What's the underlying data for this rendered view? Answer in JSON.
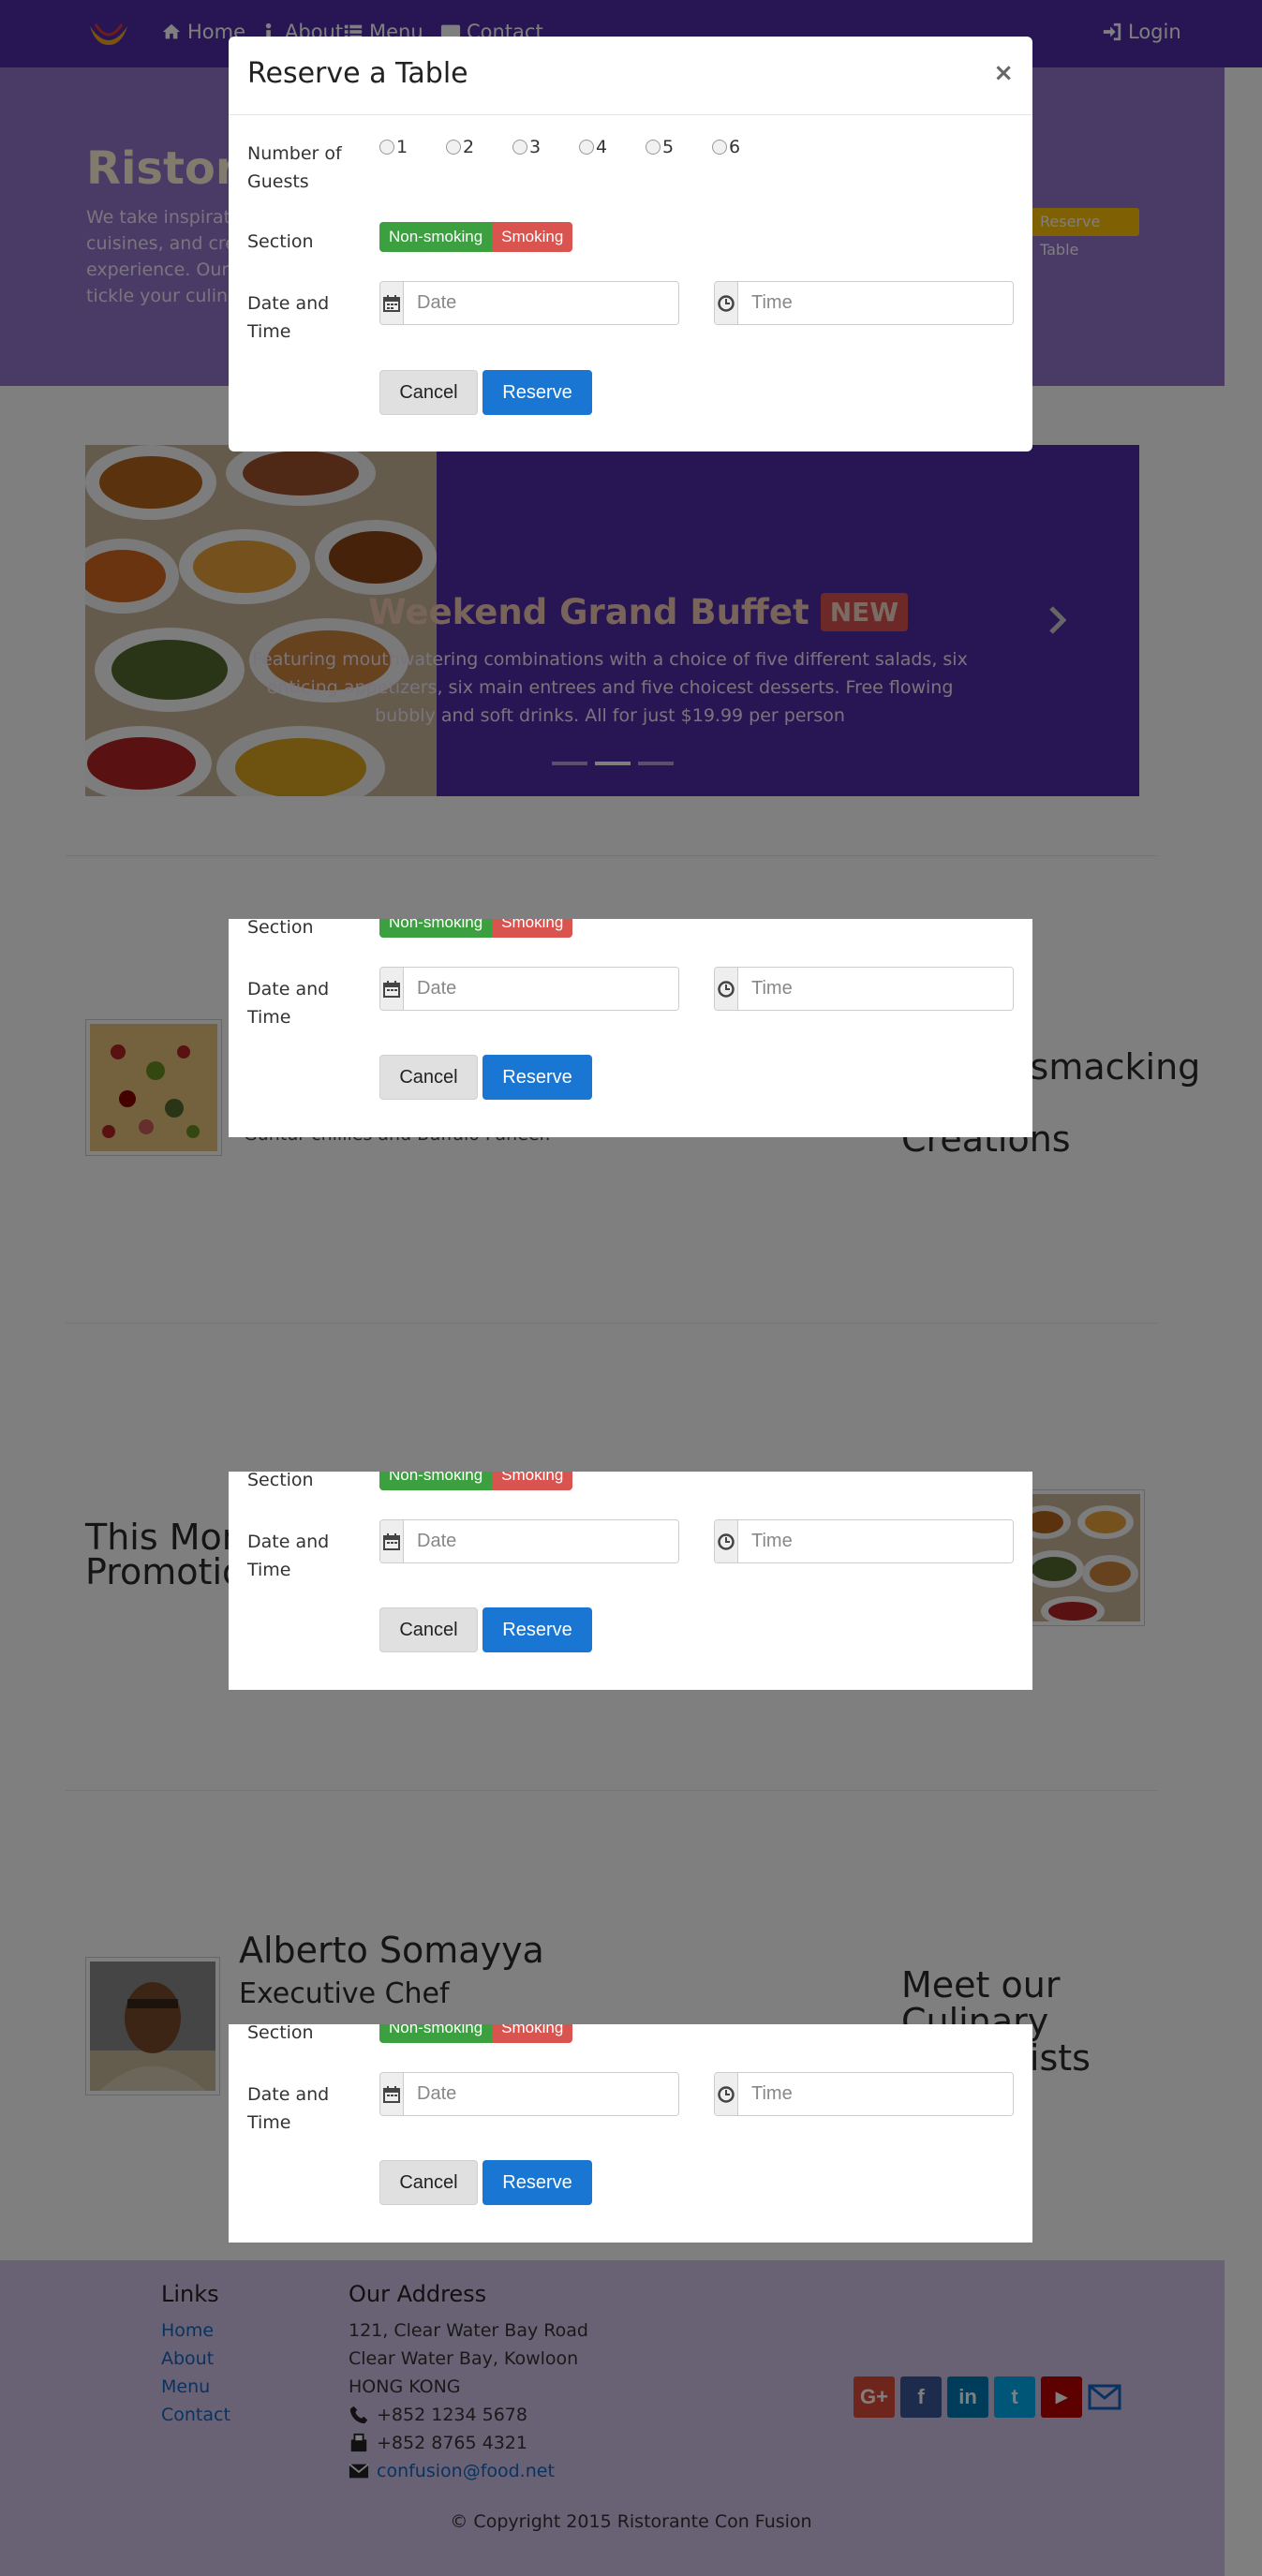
{
  "nav": {
    "items": [
      "Home",
      "About",
      "Menu",
      "Contact"
    ],
    "login": "Login"
  },
  "jumbotron": {
    "title": "Ristorante",
    "text": "We take inspiration from the World's best cuisines, and create a unique fusion experience. Our lipsmacking creations will tickle your culinary senses!",
    "button": "Reserve Table"
  },
  "carousel": {
    "title": "Weekend Grand Buffet",
    "badge": "NEW",
    "text": "Featuring mouthwatering combinations with a choice of five different salads, six enticing appetizers, six main entrees and five choicest desserts. Free flowing bubbly and soft drinks. All for just $19.99 per person"
  },
  "sections": {
    "dish_text": "Guntur chillies and Buffalo Paneer.",
    "dish_side_title_1": "Our Lipsmacking",
    "dish_side_title_2": "Creations",
    "promo_title_1": "This Month's",
    "promo_title_2": "Promotions",
    "chef_name": "Alberto Somayya",
    "chef_role": "Executive Chef",
    "chef_side_1": "Meet our",
    "chef_side_2": "Culinary",
    "chef_side_3": "Specialists"
  },
  "modal": {
    "title": "Reserve a Table",
    "close": "×",
    "guests_label": "Number of Guests",
    "guest_options": [
      "1",
      "2",
      "3",
      "4",
      "5",
      "6"
    ],
    "section_label": "Section",
    "section_options": [
      "Non-smoking",
      "Smoking"
    ],
    "datetime_label": "Date and Time",
    "date_placeholder": "Date",
    "time_placeholder": "Time",
    "cancel": "Cancel",
    "reserve": "Reserve"
  },
  "footer": {
    "links_heading": "Links",
    "links": [
      "Home",
      "About",
      "Menu",
      "Contact"
    ],
    "address_heading": "Our Address",
    "address": [
      "121, Clear Water Bay Road",
      "Clear Water Bay, Kowloon",
      "HONG KONG"
    ],
    "phone": "+852 1234 5678",
    "fax": "+852 8765 4321",
    "email": "confusion@food.net",
    "copyright": "© Copyright 2015 Ristorante Con Fusion"
  }
}
